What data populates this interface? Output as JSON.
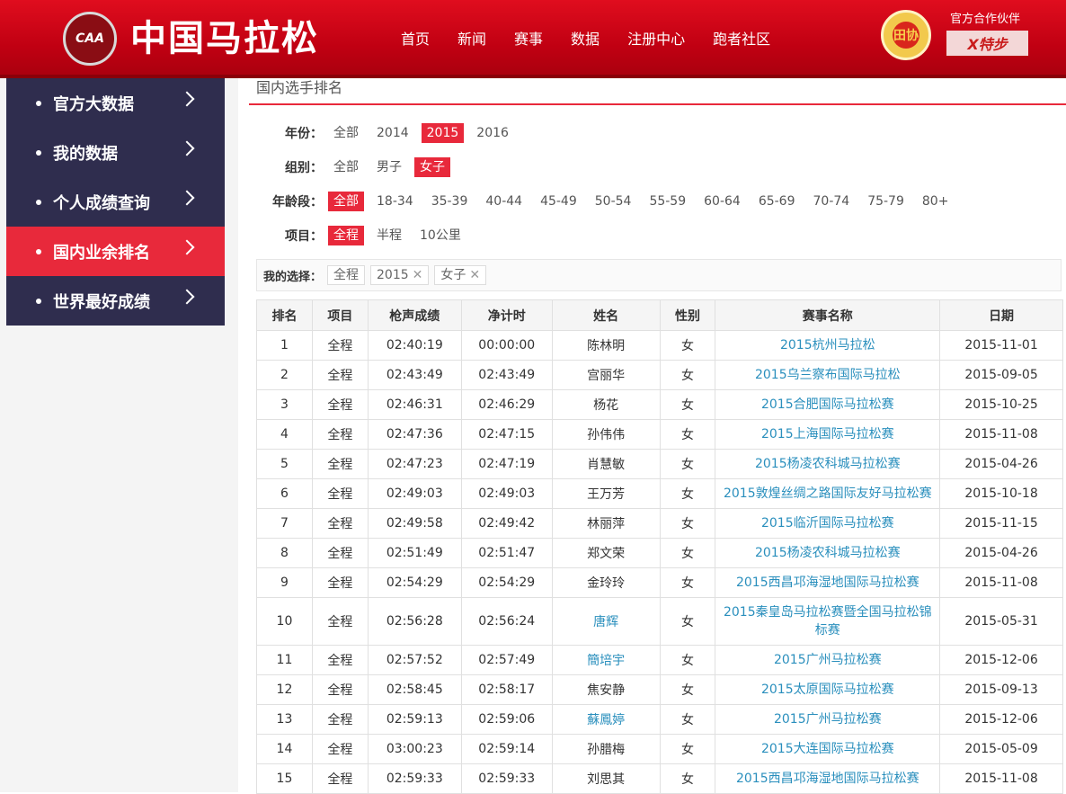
{
  "header": {
    "logo_text": "CAA",
    "site_title": "中国马拉松",
    "nav": [
      "首页",
      "新闻",
      "赛事",
      "数据",
      "注册中心",
      "跑者社区"
    ],
    "partner_title": "官方合作伙伴",
    "partner_logo": "X特步",
    "emblem_text": "田协"
  },
  "sidebar": {
    "items": [
      {
        "label": "官方大数据",
        "active": false
      },
      {
        "label": "我的数据",
        "active": false
      },
      {
        "label": "个人成绩查询",
        "active": false
      },
      {
        "label": "国内业余排名",
        "active": true
      },
      {
        "label": "世界最好成绩",
        "active": false
      }
    ]
  },
  "page": {
    "heading": "国内选手排名"
  },
  "filters": {
    "year": {
      "label": "年份：",
      "options": [
        "全部",
        "2014",
        "2015",
        "2016"
      ],
      "selected": "2015"
    },
    "group": {
      "label": "组别：",
      "options": [
        "全部",
        "男子",
        "女子"
      ],
      "selected": "女子"
    },
    "age": {
      "label": "年龄段：",
      "options": [
        "全部",
        "18-34",
        "35-39",
        "40-44",
        "45-49",
        "50-54",
        "55-59",
        "60-64",
        "65-69",
        "70-74",
        "75-79",
        "80+"
      ],
      "selected": "全部"
    },
    "event": {
      "label": "项目：",
      "options": [
        "全程",
        "半程",
        "10公里"
      ],
      "selected": "全程"
    }
  },
  "my_choice": {
    "label": "我的选择：",
    "chips": [
      {
        "text": "全程",
        "removable": false
      },
      {
        "text": "2015",
        "removable": true
      },
      {
        "text": "女子",
        "removable": true
      }
    ]
  },
  "table": {
    "headers": [
      "排名",
      "项目",
      "枪声成绩",
      "净计时",
      "姓名",
      "性别",
      "赛事名称",
      "日期"
    ],
    "rows": [
      {
        "rank": "1",
        "event": "全程",
        "gun": "02:40:19",
        "net": "00:00:00",
        "name": "陈林明",
        "name_link": false,
        "sex": "女",
        "race": "2015杭州马拉松",
        "date": "2015-11-01"
      },
      {
        "rank": "2",
        "event": "全程",
        "gun": "02:43:49",
        "net": "02:43:49",
        "name": "宫丽华",
        "name_link": false,
        "sex": "女",
        "race": "2015乌兰察布国际马拉松",
        "date": "2015-09-05"
      },
      {
        "rank": "3",
        "event": "全程",
        "gun": "02:46:31",
        "net": "02:46:29",
        "name": "杨花",
        "name_link": false,
        "sex": "女",
        "race": "2015合肥国际马拉松赛",
        "date": "2015-10-25"
      },
      {
        "rank": "4",
        "event": "全程",
        "gun": "02:47:36",
        "net": "02:47:15",
        "name": "孙伟伟",
        "name_link": false,
        "sex": "女",
        "race": "2015上海国际马拉松赛",
        "date": "2015-11-08"
      },
      {
        "rank": "5",
        "event": "全程",
        "gun": "02:47:23",
        "net": "02:47:19",
        "name": "肖慧敏",
        "name_link": false,
        "sex": "女",
        "race": "2015杨凌农科城马拉松赛",
        "date": "2015-04-26"
      },
      {
        "rank": "6",
        "event": "全程",
        "gun": "02:49:03",
        "net": "02:49:03",
        "name": "王万芳",
        "name_link": false,
        "sex": "女",
        "race": "2015敦煌丝绸之路国际友好马拉松赛",
        "date": "2015-10-18"
      },
      {
        "rank": "7",
        "event": "全程",
        "gun": "02:49:58",
        "net": "02:49:42",
        "name": "林丽萍",
        "name_link": false,
        "sex": "女",
        "race": "2015临沂国际马拉松赛",
        "date": "2015-11-15"
      },
      {
        "rank": "8",
        "event": "全程",
        "gun": "02:51:49",
        "net": "02:51:47",
        "name": "郑文荣",
        "name_link": false,
        "sex": "女",
        "race": "2015杨凌农科城马拉松赛",
        "date": "2015-04-26"
      },
      {
        "rank": "9",
        "event": "全程",
        "gun": "02:54:29",
        "net": "02:54:29",
        "name": "金玲玲",
        "name_link": false,
        "sex": "女",
        "race": "2015西昌邛海湿地国际马拉松赛",
        "date": "2015-11-08"
      },
      {
        "rank": "10",
        "event": "全程",
        "gun": "02:56:28",
        "net": "02:56:24",
        "name": "唐辉",
        "name_link": true,
        "sex": "女",
        "race": "2015秦皇岛马拉松赛暨全国马拉松锦标赛",
        "date": "2015-05-31"
      },
      {
        "rank": "11",
        "event": "全程",
        "gun": "02:57:52",
        "net": "02:57:49",
        "name": "簡培宇",
        "name_link": true,
        "sex": "女",
        "race": "2015广州马拉松赛",
        "date": "2015-12-06"
      },
      {
        "rank": "12",
        "event": "全程",
        "gun": "02:58:45",
        "net": "02:58:17",
        "name": "焦安静",
        "name_link": false,
        "sex": "女",
        "race": "2015太原国际马拉松赛",
        "date": "2015-09-13"
      },
      {
        "rank": "13",
        "event": "全程",
        "gun": "02:59:13",
        "net": "02:59:06",
        "name": "蘇鳳婷",
        "name_link": true,
        "sex": "女",
        "race": "2015广州马拉松赛",
        "date": "2015-12-06"
      },
      {
        "rank": "14",
        "event": "全程",
        "gun": "03:00:23",
        "net": "02:59:14",
        "name": "孙腊梅",
        "name_link": false,
        "sex": "女",
        "race": "2015大连国际马拉松赛",
        "date": "2015-05-09"
      },
      {
        "rank": "15",
        "event": "全程",
        "gun": "02:59:33",
        "net": "02:59:33",
        "name": "刘思其",
        "name_link": false,
        "sex": "女",
        "race": "2015西昌邛海湿地国际马拉松赛",
        "date": "2015-11-08"
      }
    ]
  },
  "colors": {
    "brand_red": "#e8293b",
    "sidebar_dark": "#2f2d4e",
    "link_blue": "#2a8fbd"
  }
}
